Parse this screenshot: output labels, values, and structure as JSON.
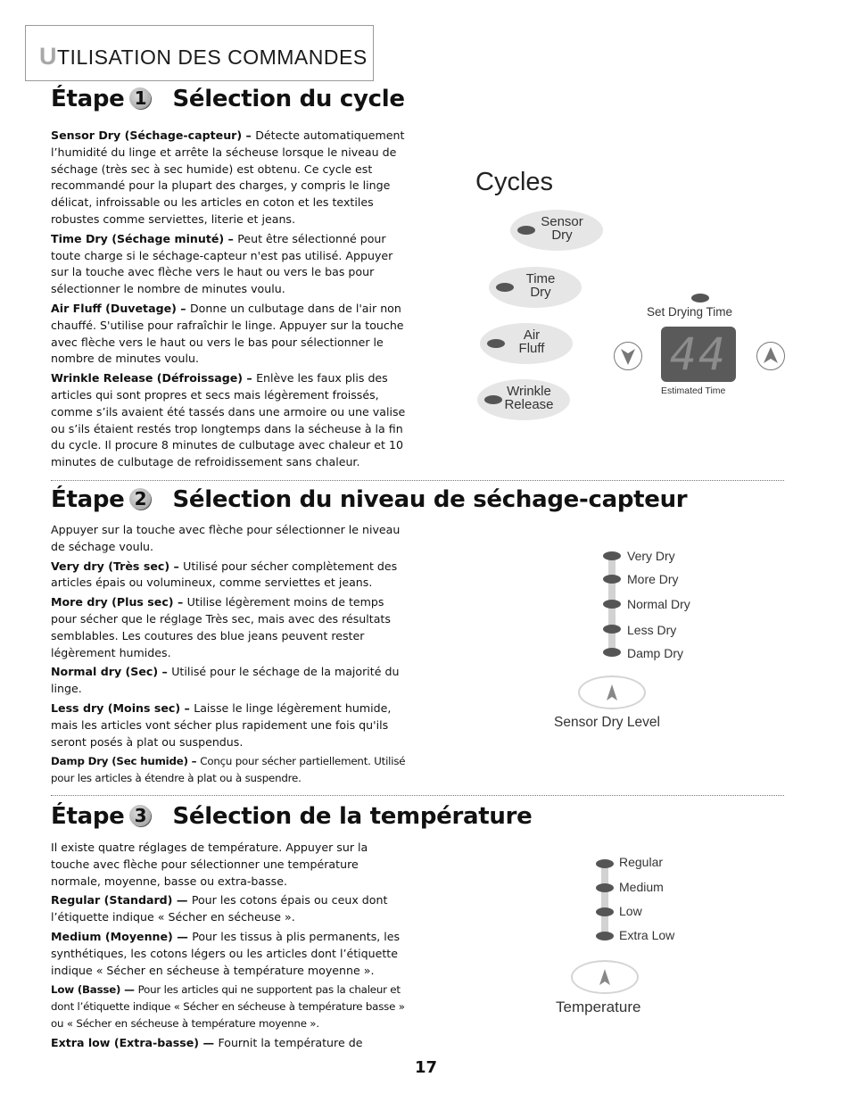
{
  "header": {
    "initial": "U",
    "rest": "TILISATION DES COMMANDES"
  },
  "steps": [
    {
      "prefix": "Étape",
      "number": "1",
      "title": "Sélection du cycle",
      "paragraphs": [
        {
          "term": "Sensor Dry (Séchage-capteur)",
          "sep": " – ",
          "text": "Détecte automatiquement l’humidité du linge et arrête la sécheuse lorsque le niveau de séchage (très sec à sec humide) est obtenu. Ce cycle est recommandé pour la plupart des charges, y compris le linge délicat, infroissable ou les articles en coton et les textiles robustes comme serviettes, literie et jeans."
        },
        {
          "term": "Time Dry (Séchage minuté)",
          "sep": " – ",
          "text": "Peut être sélectionné pour toute charge si le séchage-capteur n'est pas utilisé. Appuyer sur la touche avec flèche vers le haut ou vers le bas pour sélectionner le nombre de minutes voulu."
        },
        {
          "term": "Air Fluff (Duvetage)",
          "sep": " – ",
          "text": "Donne un culbutage dans de l'air non chauffé. S'utilise pour rafraîchir le linge. Appuyer sur la touche avec flèche vers le haut ou vers le bas pour sélectionner le nombre de minutes voulu."
        },
        {
          "term": "Wrinkle Release (Défroissage)",
          "sep": " – ",
          "text": "Enlève les faux plis des articles qui sont propres et secs mais légèrement froissés, comme s’ils avaient été tassés dans une armoire ou une valise ou s’ils étaient restés trop longtemps dans la sécheuse à la fin du cycle. Il procure 8 minutes de culbutage avec chaleur et 10 minutes de culbutage de refroidissement sans chaleur."
        }
      ]
    },
    {
      "prefix": "Étape",
      "number": "2",
      "title": "Sélection du niveau de séchage-capteur",
      "intro": "Appuyer sur la touche avec flèche pour sélectionner le niveau de séchage voulu.",
      "paragraphs": [
        {
          "term": "Very dry (Très sec)",
          "sep": " – ",
          "text": "Utilisé pour sécher complètement des articles épais ou volumineux, comme serviettes et jeans."
        },
        {
          "term": "More dry (Plus sec)",
          "sep": " – ",
          "text": "Utilise légèrement moins de temps pour sécher que le réglage Très sec, mais avec des résultats semblables. Les coutures des blue jeans peuvent rester légèrement humides."
        },
        {
          "term": "Normal dry (Sec)",
          "sep": " – ",
          "text": "Utilisé pour le séchage de la majorité du linge."
        },
        {
          "term": "Less dry (Moins sec)",
          "sep": " – ",
          "text": "Laisse le linge légèrement humide, mais les articles vont sécher plus rapidement une fois qu'ils seront posés à plat ou suspendus."
        },
        {
          "term": "Damp Dry (Sec humide)",
          "sep": " – ",
          "text": "Conçu pour sécher partiellement. Utilisé pour les articles à étendre à plat ou à suspendre."
        }
      ]
    },
    {
      "prefix": "Étape",
      "number": "3",
      "title": "Sélection de la température",
      "intro": "Il existe quatre réglages de température. Appuyer sur la touche avec flèche pour sélectionner une température normale, moyenne, basse ou extra-basse.",
      "paragraphs": [
        {
          "term": "Regular (Standard)",
          "sep": " — ",
          "text": "Pour les cotons épais ou ceux dont l’étiquette indique « Sécher en sécheuse »."
        },
        {
          "term": "Medium (Moyenne)",
          "sep": " — ",
          "text": "Pour les tissus à plis permanents, les synthétiques, les cotons légers ou les articles dont l’étiquette indique « Sécher en sécheuse à température moyenne »."
        },
        {
          "term": "Low (Basse)",
          "sep": " — ",
          "text": "Pour les articles qui ne supportent pas la chaleur et dont l’étiquette indique « Sécher en sécheuse à température basse » ou « Sécher en sécheuse à température moyenne »."
        },
        {
          "term": "Extra low (Extra-basse)",
          "sep": " — ",
          "text": "Fournit la température de"
        }
      ]
    }
  ],
  "cycles_panel": {
    "title": "Cycles",
    "buttons": [
      {
        "line1": "Sensor",
        "line2": "Dry"
      },
      {
        "line1": "Time",
        "line2": "Dry"
      },
      {
        "line1": "Air",
        "line2": "Fluff"
      },
      {
        "line1": "Wrinkle",
        "line2": "Release"
      }
    ],
    "set_drying_time_label": "Set Drying Time",
    "display_value": "44",
    "estimated_time_label": "Estimated Time"
  },
  "sensor_dry_panel": {
    "levels": [
      "Very Dry",
      "More Dry",
      "Normal Dry",
      "Less Dry",
      "Damp Dry"
    ],
    "button_label": "Sensor Dry Level"
  },
  "temperature_panel": {
    "levels": [
      "Regular",
      "Medium",
      "Low",
      "Extra Low"
    ],
    "button_label": "Temperature"
  },
  "page_number": "17",
  "colors": {
    "header_initial": "#a8a8a8",
    "led": "#555555",
    "pill": "#e6e6e6",
    "display": "#5a5a5a",
    "track": "#d2d2d2"
  }
}
